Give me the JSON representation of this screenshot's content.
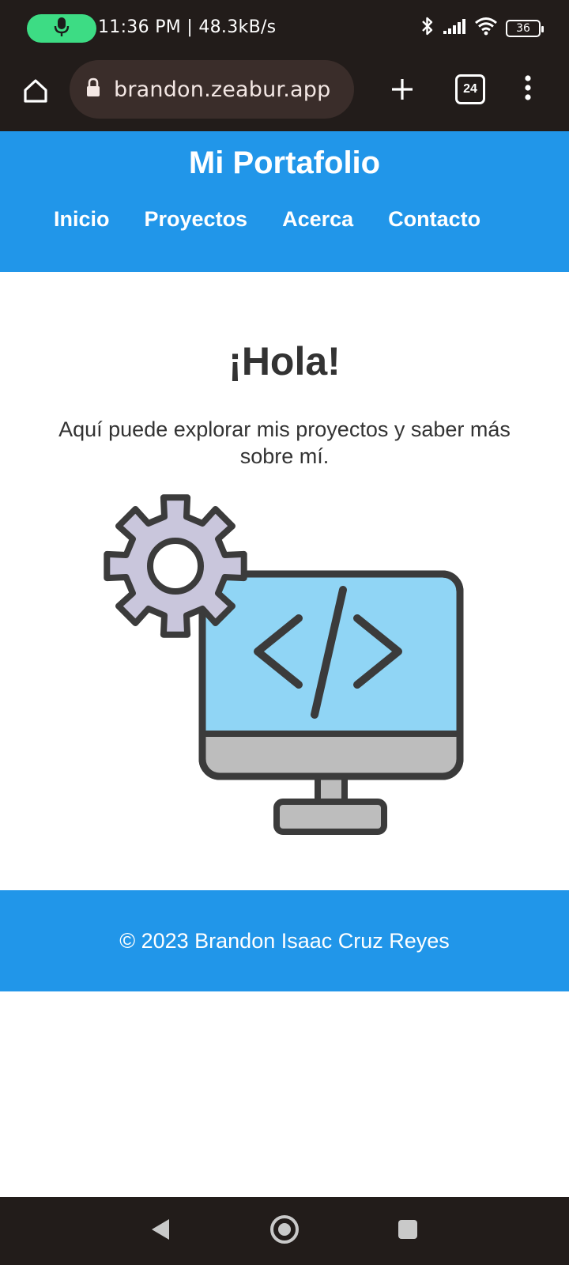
{
  "status_bar": {
    "time_speed": "11:36 PM | 48.3kB/s",
    "battery_level": "36",
    "icons": [
      "mic-icon",
      "bluetooth-icon",
      "signal-icon",
      "wifi-icon",
      "battery-icon"
    ]
  },
  "browser": {
    "url": "brandon.zeabur.app",
    "tab_count": "24",
    "icons": [
      "home-icon",
      "lock-icon",
      "plus-icon",
      "tabs-icon",
      "more-vert-icon"
    ]
  },
  "site": {
    "title": "Mi Portafolio",
    "nav": [
      {
        "label": "Inicio"
      },
      {
        "label": "Proyectos"
      },
      {
        "label": "Acerca"
      },
      {
        "label": "Contacto"
      }
    ],
    "greeting": "¡Hola!",
    "intro": "Aquí puede explorar mis proyectos y saber más sobre mí.",
    "illustration_icons": [
      "gear-icon",
      "monitor-code-icon"
    ],
    "footer": "© 2023 Brandon Isaac Cruz Reyes"
  },
  "system_nav": {
    "icons": [
      "back-icon",
      "home-circle-icon",
      "recents-icon"
    ]
  },
  "colors": {
    "header_blue": "#2196e9",
    "dark_chrome": "#221c1a",
    "url_bar": "#3a2d2a",
    "mic_green": "#3ddc84",
    "screen_blue": "#90d5f5",
    "gear_lavender": "#c9c6dc",
    "stand_gray": "#bdbdbd",
    "outline_dark": "#3b3b3b",
    "text_dark": "#333333"
  }
}
